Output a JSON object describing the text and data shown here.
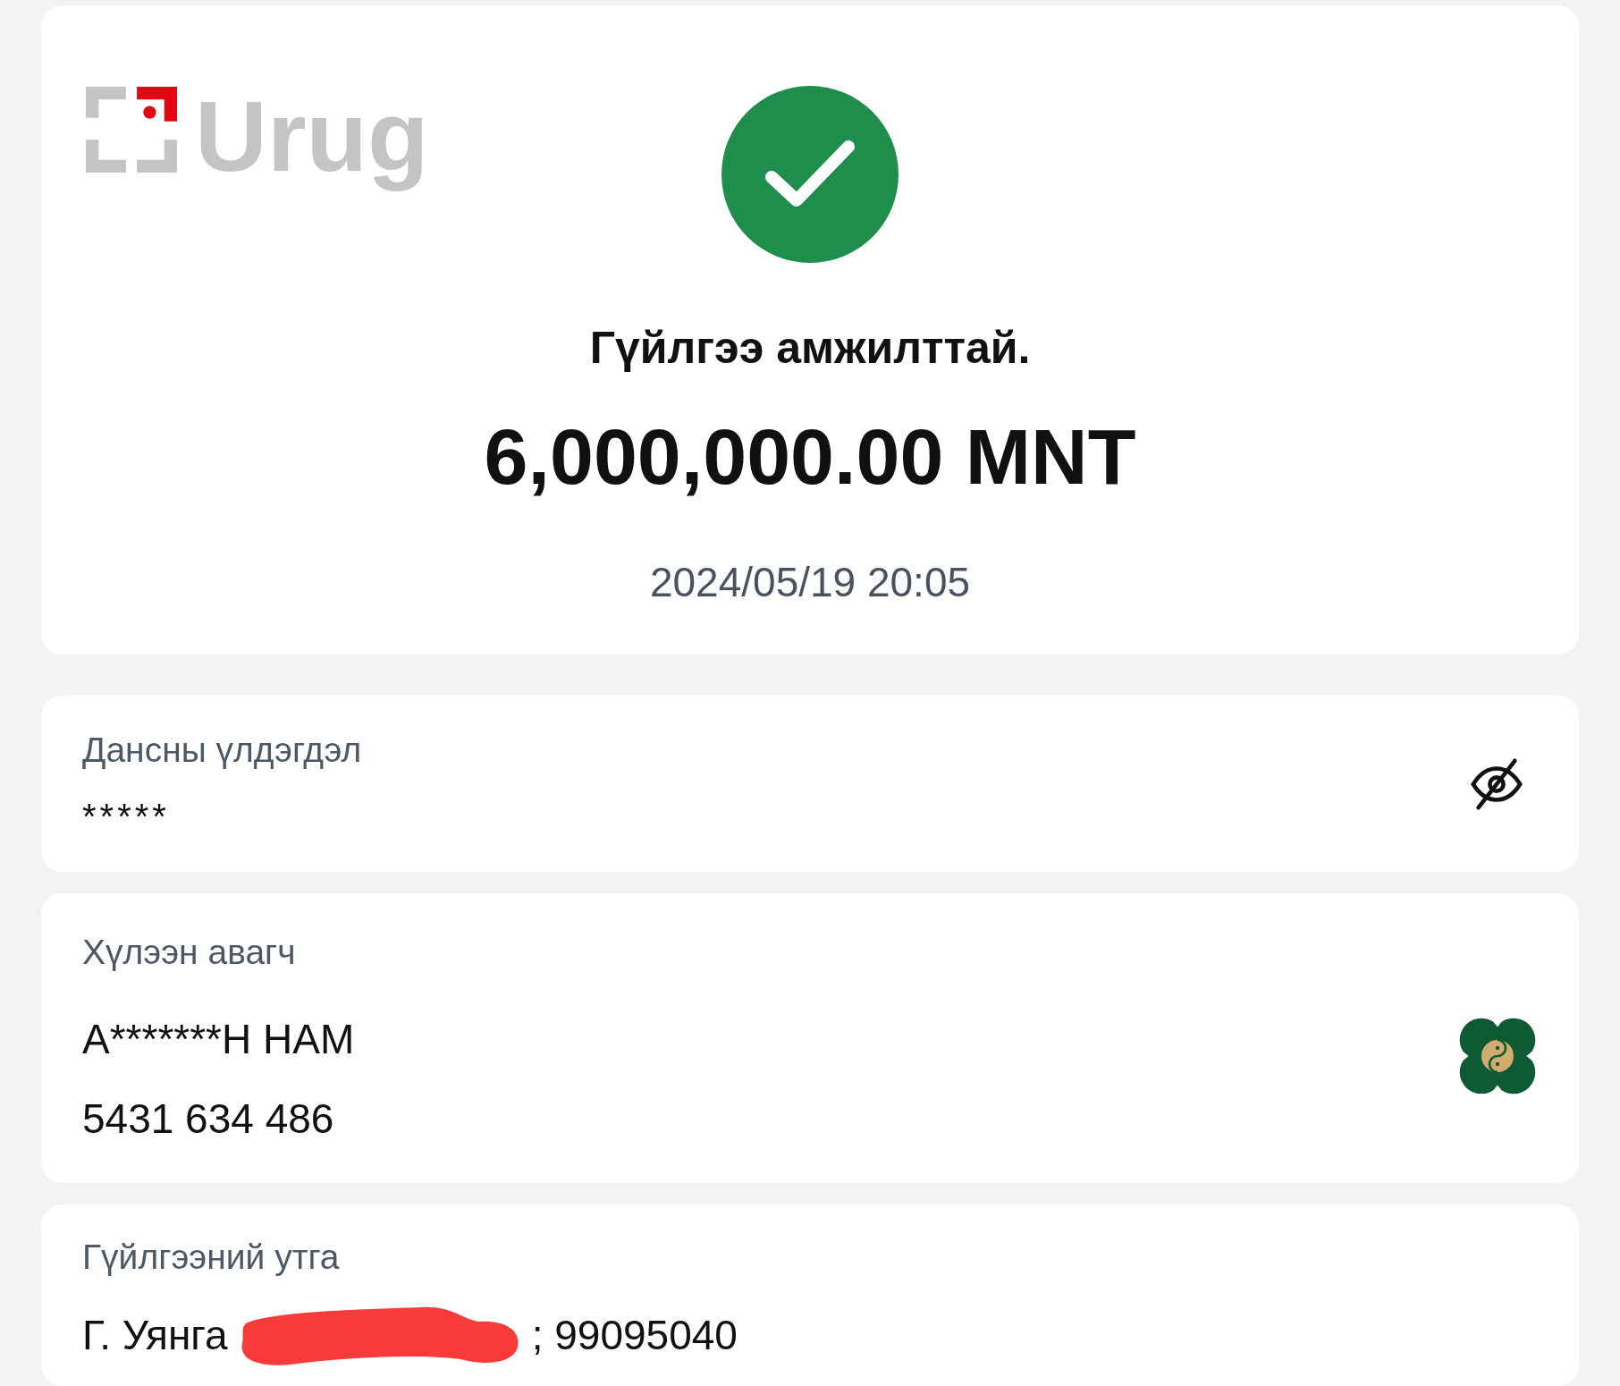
{
  "logo": {
    "text": "Urug"
  },
  "result": {
    "title": "Гүйлгээ амжилттай.",
    "amount": "6,000,000.00 MNT",
    "datetime": "2024/05/19 20:05"
  },
  "balance": {
    "label": "Дансны үлдэгдэл",
    "value": "*****",
    "hidden": true
  },
  "recipient": {
    "label": "Хүлээн авагч",
    "name": "А*******Н НАМ",
    "account": "5431 634 486"
  },
  "description": {
    "label": "Гүйлгээний утга",
    "before": "Г. Уянга",
    "after": "; 99095040",
    "redacted": true
  }
}
